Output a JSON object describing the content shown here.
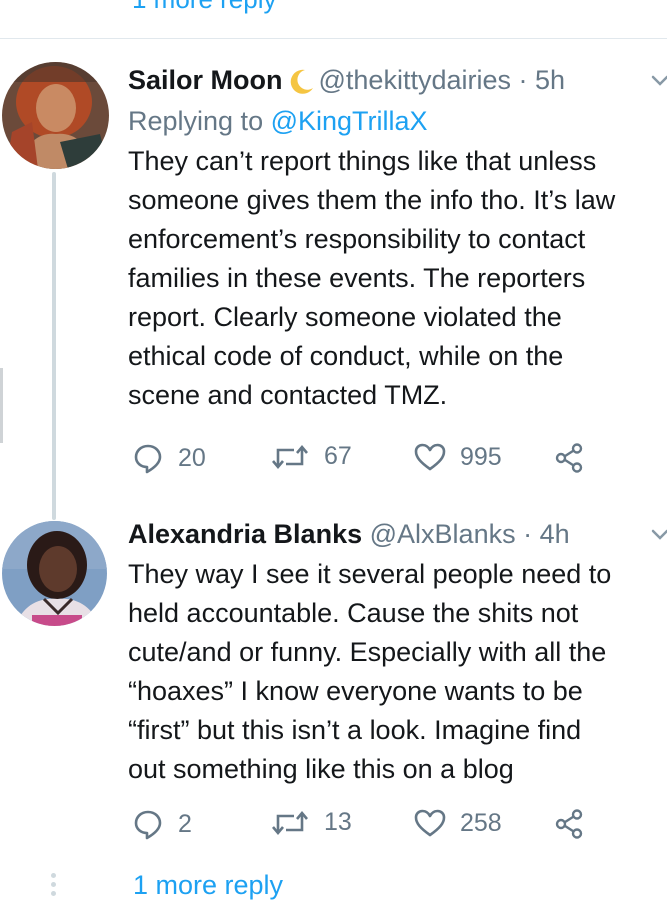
{
  "top_link": "1 more reply",
  "tweets": [
    {
      "name": "Sailor Moon",
      "handle": "@thekittydairies",
      "separator": "·",
      "time": "5h",
      "replying_prefix": "Replying to",
      "replying_to": "@KingTrillaX",
      "text": "They can’t report things like that unless\nsomeone gives them the info tho. It’s law\nenforcement’s responsibility to contact\nfamilies in these events. The reporters\nreport. Clearly someone violated the\nethical code of conduct, while on the\nscene and contacted TMZ.",
      "replies": "20",
      "retweets": "67",
      "likes": "995"
    },
    {
      "name": "Alexandria Blanks",
      "handle": "@AlxBlanks",
      "separator": "·",
      "time": "4h",
      "text": "They way I see it several people need to\nheld accountable. Cause the shits not\ncute/and or funny. Especially with all the\n“hoaxes” I know everyone wants to be\n“first” but this isn’t a look. Imagine find\nout something like this on a blog",
      "replies": "2",
      "retweets": "13",
      "likes": "258"
    }
  ],
  "more_reply": "1 more reply",
  "icons": {
    "reply": "speech-bubble-icon",
    "retweet": "retweet-arrows-icon",
    "like": "heart-outline-icon",
    "share": "share-nodes-icon",
    "moon": "crescent-moon-emoji",
    "caret": "chevron-down-icon"
  },
  "colors": {
    "link": "#1da1f2",
    "secondary_text": "#657786",
    "primary_text": "#14171a",
    "moon": "#f5c542",
    "thread_line": "#cfd9de"
  }
}
